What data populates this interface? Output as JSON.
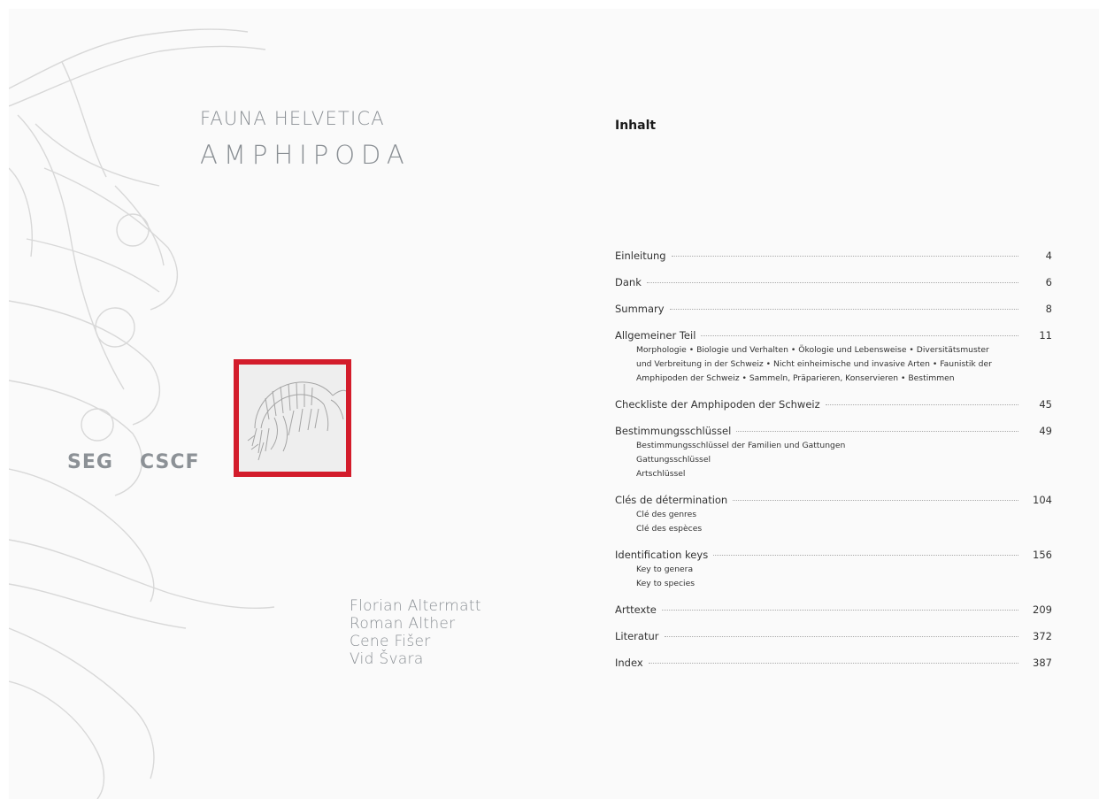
{
  "cover": {
    "series_title": "FAUNA HELVETICA",
    "volume_title": "AMPHIPODA",
    "logos": [
      "SEG",
      "CSCF"
    ],
    "authors": [
      "Florian Altermatt",
      "Roman Alther",
      "Cene Fišer",
      "Vid Švara"
    ],
    "accent_color": "#d31c2b"
  },
  "contents": {
    "heading": "Inhalt",
    "entries": [
      {
        "label": "Einleitung",
        "page": "4",
        "subs": []
      },
      {
        "label": "Dank",
        "page": "6",
        "subs": []
      },
      {
        "label": "Summary",
        "page": "8",
        "subs": []
      },
      {
        "label": "Allgemeiner Teil",
        "page": "11",
        "subs": [
          "Morphologie • Biologie und Verhalten • Ökologie und Lebensweise • Diversitätsmuster",
          "und Verbreitung in der Schweiz • Nicht einheimische und invasive Arten • Faunistik der",
          "Amphipoden der Schweiz • Sammeln, Präparieren, Konservieren • Bestimmen"
        ]
      },
      {
        "label": "Checkliste der Amphipoden der Schweiz",
        "page": "45",
        "subs": []
      },
      {
        "label": "Bestimmungsschlüssel",
        "page": "49",
        "subs": [
          "Bestimmungsschlüssel der Familien und Gattungen",
          "Gattungsschlüssel",
          "Artschlüssel"
        ]
      },
      {
        "label": "Clés de détermination",
        "page": "104",
        "subs": [
          "Clé des genres",
          "Clé des espèces"
        ]
      },
      {
        "label": "Identification keys",
        "page": "156",
        "subs": [
          "Key to genera",
          "Key to species"
        ]
      },
      {
        "label": "Arttexte",
        "page": "209",
        "subs": []
      },
      {
        "label": "Literatur",
        "page": "372",
        "subs": []
      },
      {
        "label": "Index",
        "page": "387",
        "subs": []
      }
    ]
  }
}
